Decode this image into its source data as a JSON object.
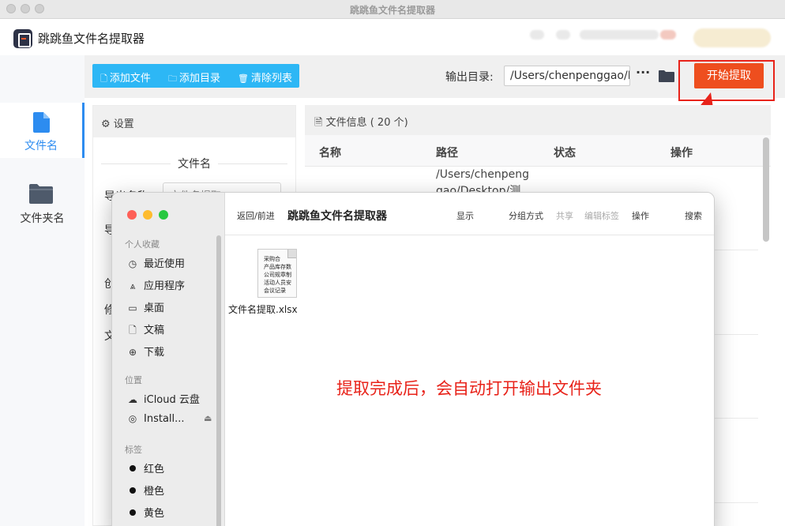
{
  "window": {
    "title": "跳跳鱼文件名提取器"
  },
  "app": {
    "name": "跳跳鱼文件名提取器"
  },
  "nav": {
    "items": [
      {
        "label": "文件名",
        "icon": "file-icon",
        "active": true
      },
      {
        "label": "文件夹名",
        "icon": "folder-icon",
        "active": false
      }
    ]
  },
  "toolbar": {
    "add_file": "添加文件",
    "add_dir": "添加目录",
    "clear_list": "清除列表",
    "output_label": "输出目录:",
    "output_path": "/Users/chenpenggao/D",
    "more": "···",
    "start": "开始提取"
  },
  "settings": {
    "header": "设置",
    "section": "文件名",
    "export_name_label": "导出名称:",
    "export_name_value": "文件名提取",
    "row_labels": [
      "导",
      "创",
      "修",
      "文"
    ]
  },
  "fileinfo": {
    "header": "文件信息 ( 20 个)",
    "columns": [
      "名称",
      "路径",
      "状态",
      "操作"
    ],
    "first_path": "/Users/chenpeng gao/Desktop/测"
  },
  "finder": {
    "nav_back_forward": "返回/前进",
    "title": "跳跳鱼文件名提取器",
    "tool_show": "显示",
    "tool_group": "分组方式",
    "tool_share": "共享",
    "tool_tags": "编辑标签",
    "tool_action": "操作",
    "tool_search": "搜索",
    "section_favorites": "个人收藏",
    "favorites": [
      {
        "label": "最近使用",
        "icon": "clock-icon"
      },
      {
        "label": "应用程序",
        "icon": "applications-icon"
      },
      {
        "label": "桌面",
        "icon": "desktop-icon"
      },
      {
        "label": "文稿",
        "icon": "document-icon"
      },
      {
        "label": "下载",
        "icon": "download-icon"
      }
    ],
    "section_locations": "位置",
    "locations": [
      {
        "label": "iCloud 云盘",
        "icon": "cloud-icon"
      },
      {
        "label": "Install...",
        "icon": "disk-icon"
      }
    ],
    "section_tags": "标签",
    "tags": [
      {
        "label": "红色"
      },
      {
        "label": "橙色"
      },
      {
        "label": "黄色"
      }
    ],
    "file": {
      "name": "文件名提取.xlsx",
      "thumb_lines": [
        "采购合",
        "产品库存数",
        "公司规章制",
        "活动人员安",
        "会议记录"
      ]
    }
  },
  "annotation": "提取完成后，会自动打开输出文件夹",
  "colors": {
    "accent_blue": "#2d8cf0",
    "toolbar_blue": "#2db7f5",
    "start_orange": "#ee4e1e",
    "annotation_red": "#e8231a"
  }
}
